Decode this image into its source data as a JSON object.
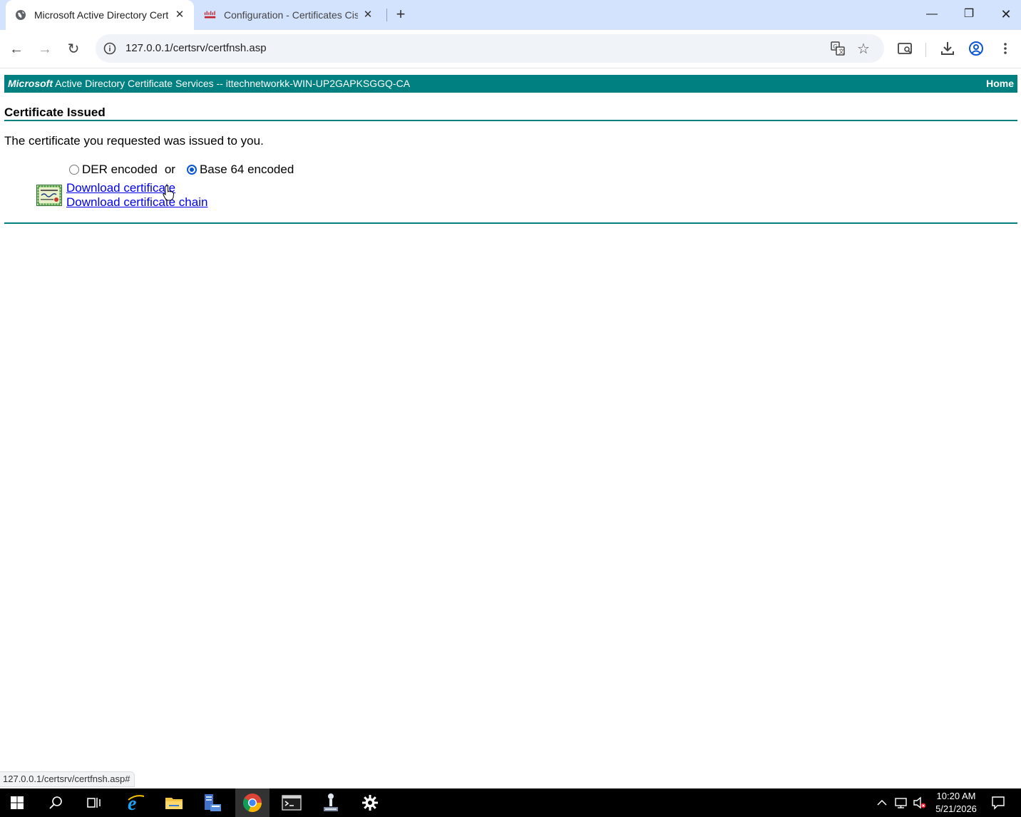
{
  "browser": {
    "tabs": [
      {
        "title": "Microsoft Active Directory Certi"
      },
      {
        "title": "Configuration - Certificates Cisc"
      }
    ],
    "url": "127.0.0.1/certsrv/certfnsh.asp",
    "status_url": "127.0.0.1/certsrv/certfnsh.asp#"
  },
  "page": {
    "header_brand": "Microsoft",
    "header_service": "Active Directory Certificate Services",
    "header_sep": "--",
    "header_ca": "ittechnetworkk-WIN-UP2GAPKSGGQ-CA",
    "home_link": "Home",
    "title": "Certificate Issued",
    "intro": "The certificate you requested was issued to you.",
    "encoding": {
      "der_label": "DER encoded",
      "or_label": "or",
      "base64_label": "Base 64 encoded",
      "selected": "Base 64 encoded"
    },
    "links": {
      "download_cert": "Download certificate",
      "download_chain": "Download certificate chain"
    }
  },
  "taskbar": {
    "time": "10:20 AM",
    "date": "5/21/2026"
  },
  "colors": {
    "teal": "#008080",
    "link": "#0000ee",
    "tabstrip": "#d3e3fd"
  }
}
